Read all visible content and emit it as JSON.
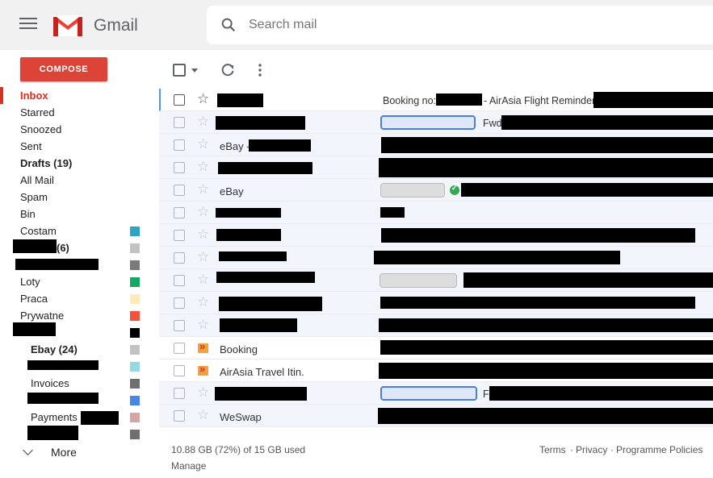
{
  "header": {
    "app_name": "Gmail",
    "search_placeholder": "Search mail"
  },
  "sidebar": {
    "compose_label": "COMPOSE",
    "items": [
      {
        "label": "Inbox"
      },
      {
        "label": "Starred"
      },
      {
        "label": "Snoozed"
      },
      {
        "label": "Sent"
      },
      {
        "label": "Drafts (19)"
      },
      {
        "label": "All Mail"
      },
      {
        "label": "Spam"
      },
      {
        "label": "Bin"
      },
      {
        "label": "Costam",
        "color": "#2ea3c4"
      },
      {
        "label": "(6)",
        "color": "#c2c2c2"
      },
      {
        "label": "",
        "color": "#7a7a7a"
      },
      {
        "label": "Loty",
        "color": "#16a765"
      },
      {
        "label": "Praca",
        "color": "#fdeab8"
      },
      {
        "label": "Prywatne",
        "color": "#f4513d"
      },
      {
        "label": "",
        "color": "#000000"
      },
      {
        "label": "Ebay (24)",
        "color": "#c2c2c2"
      },
      {
        "label": "",
        "color": "#98d7e4"
      },
      {
        "label": "Invoices",
        "color": "#6f6f6f"
      },
      {
        "label": "",
        "color": "#4986e7"
      },
      {
        "label": "Payments",
        "color": "#d5a6a6"
      },
      {
        "label": "",
        "color": "#6f6f6f"
      }
    ],
    "more_label": "More"
  },
  "mail": [
    {
      "sender": "",
      "subject": "Booking no:",
      "subject2": "- AirAsia Flight Reminder"
    },
    {
      "sender": "",
      "subject": "Fwd"
    },
    {
      "sender": "eBay -",
      "subject": ""
    },
    {
      "sender": "",
      "subject": ""
    },
    {
      "sender": "eBay",
      "subject": ""
    },
    {
      "sender": "",
      "subject": ""
    },
    {
      "sender": "",
      "subject": ""
    },
    {
      "sender": "",
      "subject": ""
    },
    {
      "sender": "",
      "subject": ""
    },
    {
      "sender": "",
      "subject": ""
    },
    {
      "sender": "",
      "subject": ""
    },
    {
      "sender": "Booking",
      "subject": ""
    },
    {
      "sender": "AirAsia Travel Itin.",
      "subject": ""
    },
    {
      "sender": "",
      "subject": "F"
    },
    {
      "sender": "WeSwap",
      "subject": ""
    }
  ],
  "footer": {
    "storage": "10.88 GB (72%) of 15 GB used",
    "manage": "Manage",
    "terms": "Terms",
    "privacy": "Privacy",
    "programme_policies": "Programme Policies",
    "sep": "·"
  },
  "colors": {
    "accent": "#db4437",
    "active_label": "#d93025",
    "unread_border": "#4d90fe"
  }
}
